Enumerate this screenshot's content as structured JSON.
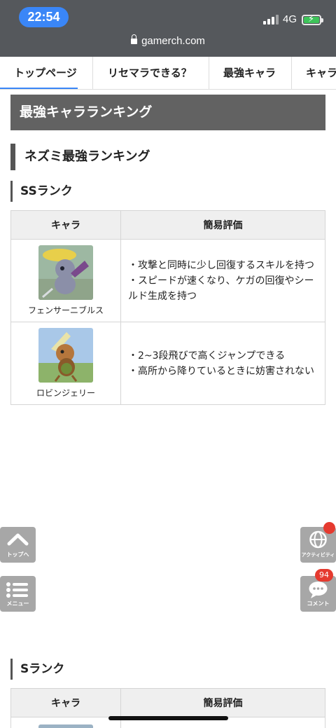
{
  "status": {
    "time": "22:54",
    "network": "4G"
  },
  "browser": {
    "url": "gamerch.com"
  },
  "tabs": [
    {
      "label": "トップページ"
    },
    {
      "label": "リセマラできる？"
    },
    {
      "label": "最強キャラ"
    },
    {
      "label": "キャラ"
    }
  ],
  "page": {
    "heading": "最強キャラランキング",
    "section_title": "ネズミ最強ランキング",
    "ss": {
      "title": "SSランク",
      "columns": [
        "キャラ",
        "簡易評価"
      ],
      "rows": [
        {
          "name": "フェンサーニブルス",
          "desc": "・攻撃と同時に少し回復するスキルを持つ\n・スピードが速くなり、ケガの回復やシールド生成を持つ"
        },
        {
          "name": "ロビンジェリー",
          "desc": "・2~3段飛びで高くジャンプできる\n・高所から降りているときに妨害されない"
        }
      ]
    },
    "s": {
      "title": "Sランク",
      "columns": [
        "キャラ",
        "簡易評価"
      ]
    }
  },
  "floating": {
    "top": "トップへ",
    "menu": "メニュー",
    "activity": "アクティビティ",
    "comment": "コメント",
    "comment_count": "94"
  },
  "colors": {
    "accent": "#3a86f7",
    "heading_bg": "#626262",
    "badge": "#e53a2f"
  }
}
